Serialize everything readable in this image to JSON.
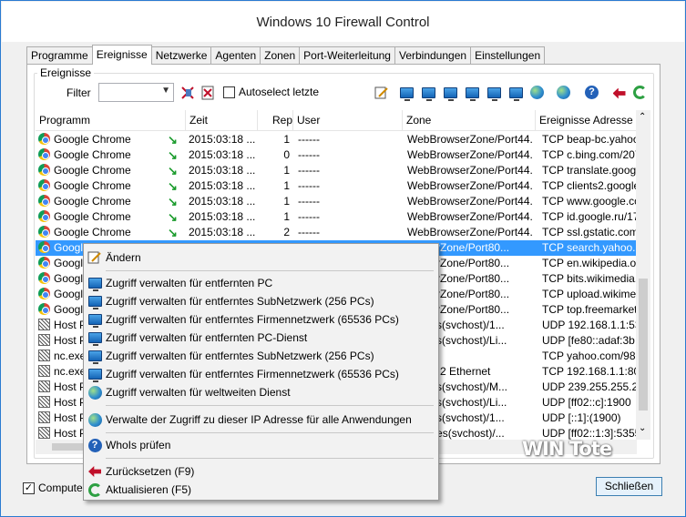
{
  "window": {
    "title": "Windows 10 Firewall Control"
  },
  "tabs": [
    "Programme",
    "Ereignisse",
    "Netzwerke",
    "Agenten",
    "Zonen",
    "Port-Weiterleitung",
    "Verbindungen",
    "Einstellungen"
  ],
  "active_tab": "Ereignisse",
  "group": {
    "label": "Ereignisse"
  },
  "filter": {
    "label": "Filter",
    "value": ""
  },
  "autoselect": {
    "label": "Autoselect letzte",
    "checked": false
  },
  "columns": [
    "Programm",
    "Zeit",
    "Rep",
    "User",
    "Zone",
    "Ereignisse Adresse"
  ],
  "rows": [
    [
      "Google Chrome",
      "2015:03:18 ...",
      "1",
      "------",
      "WebBrowserZone/Port44...",
      "TCP beap-bc.yahoo.c"
    ],
    [
      "Google Chrome",
      "2015:03:18 ...",
      "0",
      "------",
      "WebBrowserZone/Port44...",
      "TCP c.bing.com/207."
    ],
    [
      "Google Chrome",
      "2015:03:18 ...",
      "1",
      "------",
      "WebBrowserZone/Port44...",
      "TCP translate.google"
    ],
    [
      "Google Chrome",
      "2015:03:18 ...",
      "1",
      "------",
      "WebBrowserZone/Port44...",
      "TCP clients2.google.c"
    ],
    [
      "Google Chrome",
      "2015:03:18 ...",
      "1",
      "------",
      "WebBrowserZone/Port44...",
      "TCP www.google.com"
    ],
    [
      "Google Chrome",
      "2015:03:18 ...",
      "1",
      "------",
      "WebBrowserZone/Port44...",
      "TCP id.google.ru/173"
    ],
    [
      "Google Chrome",
      "2015:03:18 ...",
      "2",
      "------",
      "WebBrowserZone/Port44...",
      "TCP ssl.gstatic.com/1"
    ],
    [
      "Google",
      "",
      "",
      "",
      "rowserZone/Port80...",
      "TCP search.yahoo.co"
    ],
    [
      "Google",
      "",
      "",
      "",
      "rowserZone/Port80...",
      "TCP en.wikipedia.org"
    ],
    [
      "Google",
      "",
      "",
      "",
      "rowserZone/Port80...",
      "TCP bits.wikimedia.or"
    ],
    [
      "Google",
      "",
      "",
      "",
      "rowserZone/Port80...",
      "TCP upload.wikimedia"
    ],
    [
      "Google",
      "",
      "",
      "",
      "rowserZone/Port80...",
      "TCP top.freemarket.l"
    ],
    [
      "Host Pr",
      "",
      "",
      "",
      "ervices(svchost)/1...",
      "UDP 192.168.1.1:53"
    ],
    [
      "Host Pr",
      "",
      "",
      "",
      "ervices(svchost)/Li...",
      "UDP [fe80::adaf:3b"
    ],
    [
      "nc.exe",
      "",
      "",
      "",
      "y",
      "TCP yahoo.com/98.1"
    ],
    [
      "nc.exe",
      "",
      "",
      "",
      "y/LAN 2 Ethernet",
      "TCP 192.168.1.1:80"
    ],
    [
      "Host Pr",
      "",
      "",
      "",
      "ervices(svchost)/M...",
      "UDP 239.255.255.25"
    ],
    [
      "Host Pr",
      "",
      "",
      "",
      "ervices(svchost)/Li...",
      "UDP [ff02::c]:1900"
    ],
    [
      "Host Pr",
      "",
      "",
      "",
      "ervices(svchost)/1...",
      "UDP [::1]:(1900)"
    ],
    [
      "Host Pr",
      "",
      "",
      "",
      "Updates(svchost)/...",
      "UDP [ff02::1:3]:5355"
    ]
  ],
  "selected_row": 7,
  "context_menu": {
    "edit": "Ändern",
    "pc": "Zugriff verwalten für entfernten PC",
    "subnet": "Zugriff verwalten für entferntes SubNetzwerk (256 PCs)",
    "company": "Zugriff verwalten für entferntes Firmennetzwerk (65536 PCs)",
    "pc_service": "Zugriff verwalten für entfernten PC-Dienst",
    "subnet2": "Zugriff verwalten für entferntes SubNetzwerk (256 PCs)",
    "company2": "Zugriff verwalten für entferntes Firmennetzwerk (65536 PCs)",
    "worldwide": "Zugriff verwalten für weltweiten Dienst",
    "ip_all": "Verwalte der Zugriff zu dieser IP Adresse für alle Anwendungen",
    "whois": "WhoIs prüfen",
    "reset": "Zurücksetzen (F9)",
    "refresh": "Aktualisieren (F5)"
  },
  "bottom": {
    "checkbox_label": "Computer",
    "checked": true,
    "close_label": "Schließen"
  },
  "watermark": "WIN Tote"
}
